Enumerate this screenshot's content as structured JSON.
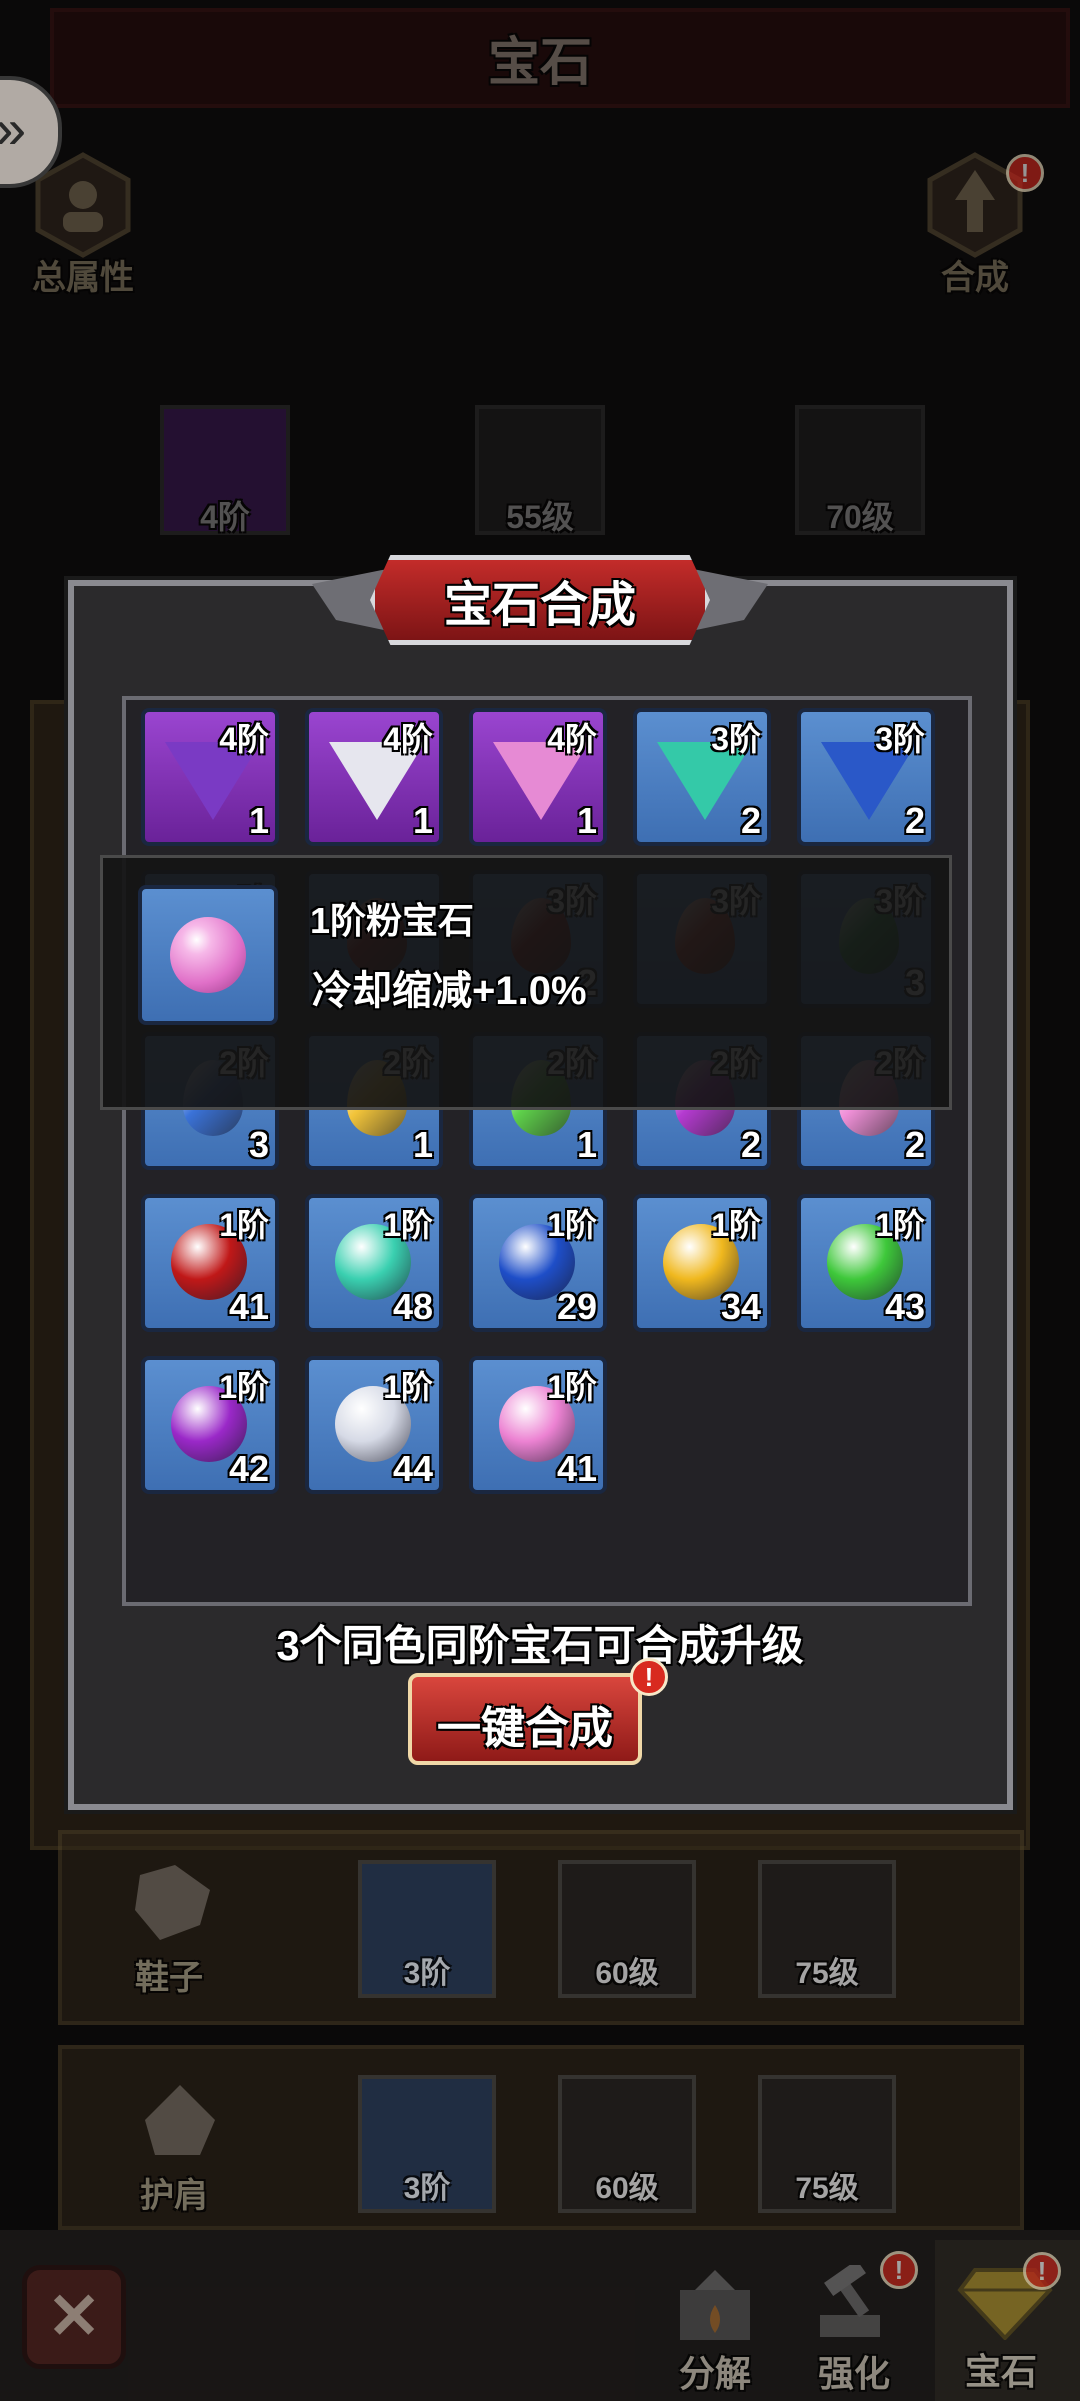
{
  "page": {
    "title": "宝石",
    "left_button_label": "总属性",
    "right_button_label": "合成"
  },
  "background_slots": [
    {
      "label": "4阶"
    },
    {
      "label": "55级"
    },
    {
      "label": "70级"
    }
  ],
  "equipment_rows": [
    {
      "name": "鞋子",
      "slots": [
        {
          "label": "3阶"
        },
        {
          "label": "60级"
        },
        {
          "label": "75级"
        }
      ]
    },
    {
      "name": "护肩",
      "slots": [
        {
          "label": "3阶"
        },
        {
          "label": "60级"
        },
        {
          "label": "75级"
        }
      ]
    }
  ],
  "modal": {
    "title": "宝石合成",
    "hint": "3个同色同阶宝石可合成升级",
    "merge_button": "一键合成",
    "alert_mark": "!"
  },
  "tooltip": {
    "gem_name": "1阶粉宝石",
    "effect": "冷却缩减+1.0%"
  },
  "gem_grid": [
    [
      {
        "tier": "4阶",
        "count": "1",
        "bg": "purple",
        "color": "#7a3ac4",
        "shape": "tri"
      },
      {
        "tier": "4阶",
        "count": "1",
        "bg": "purple",
        "color": "#e6e6ee",
        "shape": "tri"
      },
      {
        "tier": "4阶",
        "count": "1",
        "bg": "purple",
        "color": "#e68ad4",
        "shape": "tri"
      },
      {
        "tier": "3阶",
        "count": "2",
        "bg": "blue",
        "color": "#34c9a8",
        "shape": "tri"
      },
      {
        "tier": "3阶",
        "count": "2",
        "bg": "blue",
        "color": "#2a58c8",
        "shape": "tri"
      }
    ],
    [
      {
        "tier": "3阶",
        "count": "",
        "bg": "blue",
        "color": "#c83a82",
        "shape": "tri"
      },
      {
        "tier": "",
        "count": "",
        "bg": "blue",
        "color": "#a02020",
        "shape": "drop"
      },
      {
        "tier": "3阶",
        "count": "2",
        "bg": "blue",
        "color": "#a02020",
        "shape": "drop"
      },
      {
        "tier": "3阶",
        "count": "",
        "bg": "blue",
        "color": "#c83a2a",
        "shape": "drop"
      },
      {
        "tier": "3阶",
        "count": "3",
        "bg": "blue",
        "color": "#2a9a4a",
        "shape": "drop"
      }
    ],
    [
      {
        "tier": "2阶",
        "count": "3",
        "bg": "blue",
        "color": "#3a72d8",
        "shape": "drop"
      },
      {
        "tier": "2阶",
        "count": "1",
        "bg": "blue",
        "color": "#f2c43a",
        "shape": "drop"
      },
      {
        "tier": "2阶",
        "count": "1",
        "bg": "blue",
        "color": "#5ed04a",
        "shape": "drop"
      },
      {
        "tier": "2阶",
        "count": "2",
        "bg": "blue",
        "color": "#b43ad0",
        "shape": "drop"
      },
      {
        "tier": "2阶",
        "count": "2",
        "bg": "blue",
        "color": "#f090d8",
        "shape": "drop"
      }
    ],
    [
      {
        "tier": "1阶",
        "count": "41",
        "bg": "blue",
        "color": "#c01818",
        "shape": "ball"
      },
      {
        "tier": "1阶",
        "count": "48",
        "bg": "blue",
        "color": "#3ad0b0",
        "shape": "ball"
      },
      {
        "tier": "1阶",
        "count": "29",
        "bg": "blue",
        "color": "#1e4ec8",
        "shape": "ball"
      },
      {
        "tier": "1阶",
        "count": "34",
        "bg": "blue",
        "color": "#f0b81e",
        "shape": "ball"
      },
      {
        "tier": "1阶",
        "count": "43",
        "bg": "blue",
        "color": "#3ec83a",
        "shape": "ball"
      }
    ],
    [
      {
        "tier": "1阶",
        "count": "42",
        "bg": "blue",
        "color": "#9a28c8",
        "shape": "ball"
      },
      {
        "tier": "1阶",
        "count": "44",
        "bg": "blue",
        "color": "#d6dae6",
        "shape": "ball"
      },
      {
        "tier": "1阶",
        "count": "41",
        "bg": "blue",
        "color": "#ec82d2",
        "shape": "ball"
      }
    ]
  ],
  "bottom_tabs": [
    {
      "label": "分解",
      "alert": false
    },
    {
      "label": "强化",
      "alert": true
    },
    {
      "label": "宝石",
      "alert": true
    }
  ]
}
